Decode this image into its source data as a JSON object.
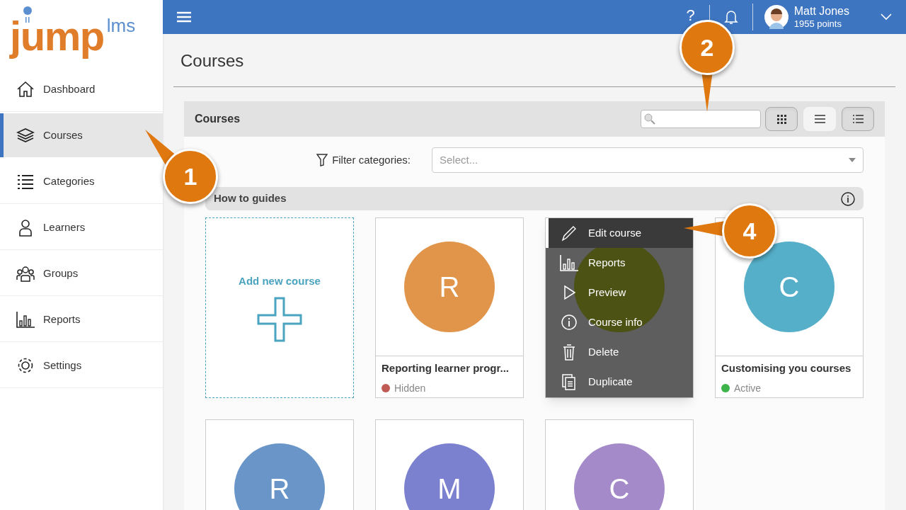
{
  "logo": {
    "main": "jump",
    "suffix": "lms"
  },
  "sidebar": {
    "items": [
      {
        "label": "Dashboard",
        "kind": "home",
        "selected": false
      },
      {
        "label": "Courses",
        "kind": "books",
        "selected": true
      },
      {
        "label": "Categories",
        "kind": "list",
        "selected": false
      },
      {
        "label": "Learners",
        "kind": "person",
        "selected": false
      },
      {
        "label": "Groups",
        "kind": "people",
        "selected": false
      },
      {
        "label": "Reports",
        "kind": "chart",
        "selected": false
      },
      {
        "label": "Settings",
        "kind": "gear",
        "selected": false
      }
    ]
  },
  "topbar": {
    "help": "?",
    "user": {
      "name": "Matt Jones",
      "points": "1955 points"
    }
  },
  "page_title": "Courses",
  "panel": {
    "title": "Courses",
    "views": [
      {
        "kind": "grid",
        "selected": false
      },
      {
        "kind": "rows",
        "selected": true
      },
      {
        "kind": "list",
        "selected": false
      }
    ],
    "filter": {
      "label": "Filter categories:",
      "placeholder": "Select..."
    },
    "section": "How to guides",
    "cards": [
      {
        "kind": "add",
        "title": "Add new course"
      },
      {
        "kind": "course",
        "letter": "R",
        "color": "#e0954a",
        "title": "Reporting learner progr...",
        "status": {
          "label": "Hidden",
          "color": "#c05a55"
        }
      },
      {
        "kind": "course",
        "color": "#4b5213",
        "menu": [
          {
            "label": "Edit course",
            "kind": "edit",
            "selected": true
          },
          {
            "label": "Reports",
            "kind": "chart",
            "selected": false
          },
          {
            "label": "Preview",
            "kind": "play",
            "selected": false
          },
          {
            "label": "Course info",
            "kind": "info",
            "selected": false
          },
          {
            "label": "Delete",
            "kind": "trash",
            "selected": false
          },
          {
            "label": "Duplicate",
            "kind": "copy",
            "selected": false
          }
        ]
      },
      {
        "kind": "course",
        "letter": "C",
        "color": "#56afc9",
        "title": "Customising you courses",
        "status": {
          "label": "Active",
          "color": "#3cb44a"
        }
      },
      {
        "kind": "course",
        "letter": "R",
        "color": "#6a95c9"
      },
      {
        "kind": "course",
        "letter": "M",
        "color": "#7b80cf"
      },
      {
        "kind": "course",
        "letter": "C",
        "color": "#a48ac8"
      }
    ]
  },
  "callouts": [
    {
      "label": "1"
    },
    {
      "label": "2"
    },
    {
      "label": "4"
    }
  ]
}
